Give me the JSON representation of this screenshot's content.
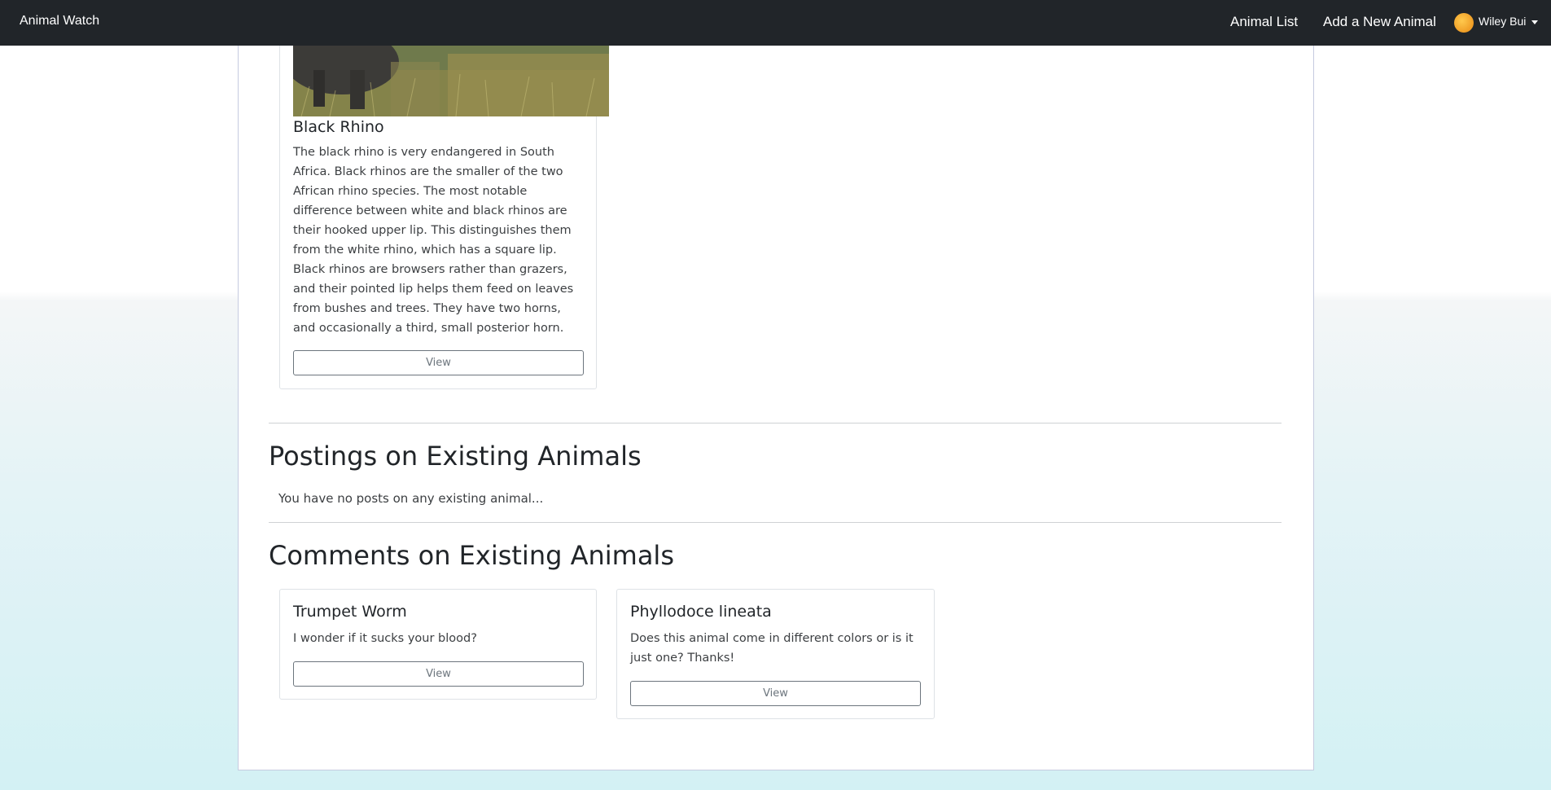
{
  "navbar": {
    "brand": "Animal Watch",
    "links": [
      "Animal List",
      "Add a New Animal"
    ],
    "user": "Wiley Bui"
  },
  "my_animals": [
    {
      "title": "Black Rhino",
      "text": "The black rhino is very endangered in South Africa. Black rhinos are the smaller of the two African rhino species. The most notable difference between white and black rhinos are their hooked upper lip. This distinguishes them from the white rhino, which has a square lip. Black rhinos are browsers rather than grazers, and their pointed lip helps them feed on leaves from bushes and trees. They have two horns, and occasionally a third, small posterior horn.",
      "button": "View"
    }
  ],
  "postings": {
    "heading": "Postings on Existing Animals",
    "empty": "You have no posts on any existing animal..."
  },
  "comments": {
    "heading": "Comments on Existing Animals",
    "items": [
      {
        "title": "Trumpet Worm",
        "text": "I wonder if it sucks your blood?",
        "button": "View"
      },
      {
        "title": "Phyllodoce lineata",
        "text": "Does this animal come in different colors or is it just one? Thanks!",
        "button": "View"
      }
    ]
  }
}
